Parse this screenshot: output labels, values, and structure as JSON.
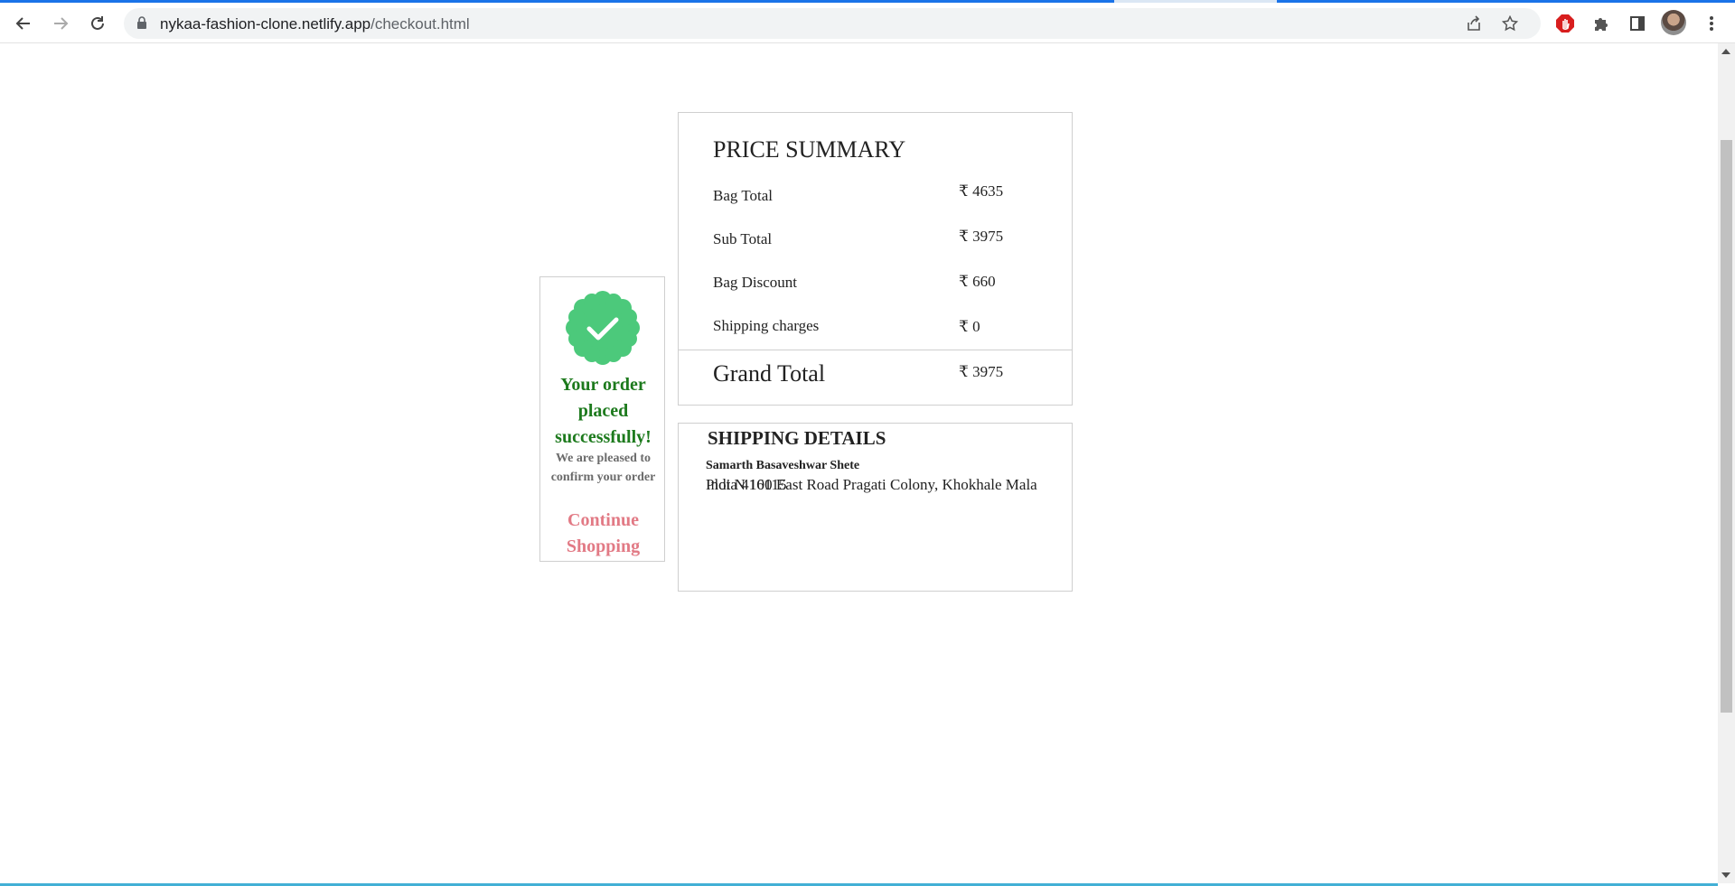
{
  "browser": {
    "url_domain": "nykaa-fashion-clone.netlify.app",
    "url_path": "/checkout.html",
    "icons": {
      "back": "arrow-left-icon",
      "forward": "arrow-right-icon",
      "reload": "reload-icon",
      "lock": "lock-icon",
      "share": "share-icon",
      "bookmark": "star-icon",
      "adblock": "stop-hand-icon",
      "extensions": "puzzle-icon",
      "sidepanel": "side-panel-icon",
      "menu": "kebab-menu-icon"
    },
    "accent_color": "#1a73e8"
  },
  "success": {
    "title": "Your order placed successfully!",
    "subtitle": "We are pleased to confirm your order",
    "continue_label": "Continue Shopping",
    "badge_color": "#4cc97b",
    "title_color": "#1d7a1d",
    "link_color": "#e27a85"
  },
  "price_summary": {
    "heading": "PRICE SUMMARY",
    "rows": [
      {
        "label": "Bag Total",
        "value": "₹ 4635"
      },
      {
        "label": "Sub Total",
        "value": "₹ 3975"
      },
      {
        "label": "Bag Discount",
        "value": "₹ 660"
      },
      {
        "label": "Shipping charges",
        "value": "₹ 0"
      }
    ],
    "grand_total_label": "Grand Total",
    "grand_total_value": "₹ 3975"
  },
  "shipping": {
    "heading": "SHIPPING DETAILS",
    "name": "Samarth Basaveshwar Shete",
    "address_line1": "Plot N 100 East Road Pragati Colony, Khokhale Mala",
    "address_line2": "India 416115"
  }
}
